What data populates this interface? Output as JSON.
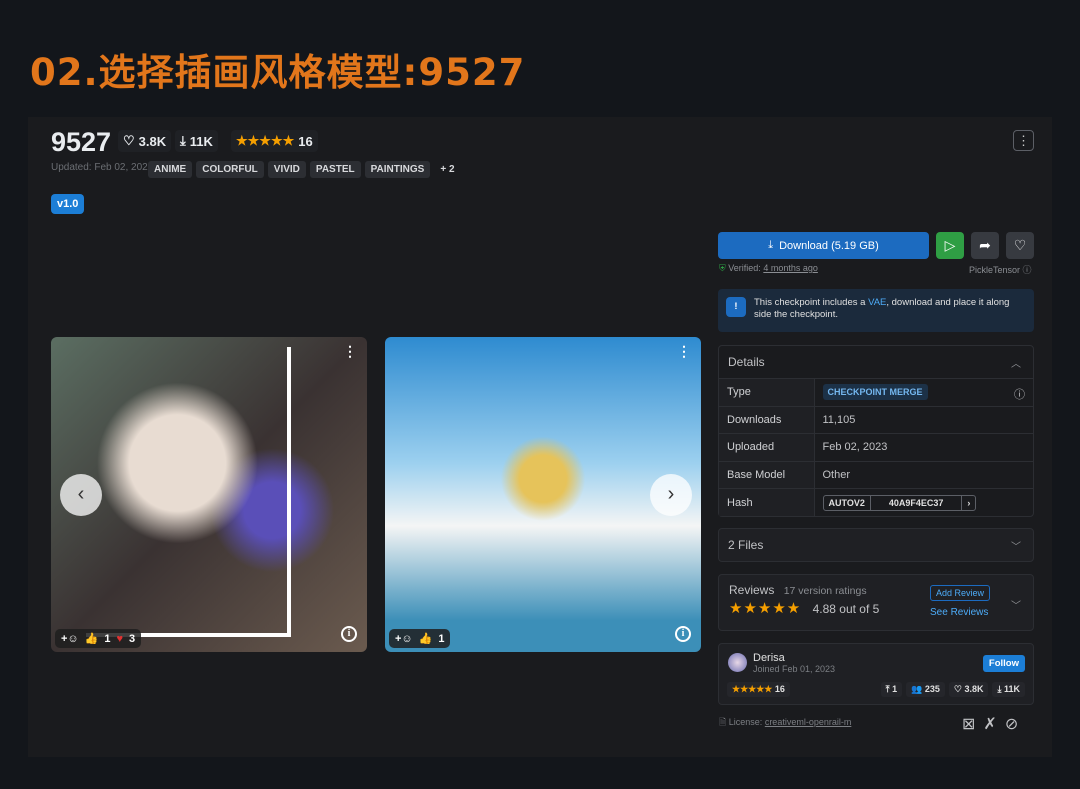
{
  "heading": "02.选择插画风格模型:9527",
  "model": {
    "title": "9527",
    "likes": "3.8K",
    "downloads": "11K",
    "rating_stars": 5,
    "rating_count": "16",
    "updated": "Updated: Feb 02, 2023",
    "tags": [
      "ANIME",
      "COLORFUL",
      "VIVID",
      "PASTEL",
      "PAINTINGS",
      "+ 2"
    ],
    "version": "v1.0"
  },
  "gallery": [
    {
      "thumbs_up": "1",
      "hearts": "3"
    },
    {
      "thumbs_up": "1"
    }
  ],
  "actions": {
    "download_label": "Download (5.19 GB)",
    "verified_prefix": "Verified:",
    "verified_time": "4 months ago",
    "verifier": "PickleTensor",
    "accent": "#1c6bc0",
    "run_color": "#2f9e44"
  },
  "alert": {
    "pre": "This checkpoint includes a ",
    "link": "VAE",
    "post": ", download and place it along side the checkpoint."
  },
  "details": {
    "title": "Details",
    "rows": [
      {
        "label": "Type",
        "value": "CHECKPOINT MERGE"
      },
      {
        "label": "Downloads",
        "value": "11,105"
      },
      {
        "label": "Uploaded",
        "value": "Feb 02, 2023"
      },
      {
        "label": "Base Model",
        "value": "Other"
      },
      {
        "label": "Hash",
        "hash_type": "AUTOV2",
        "hash": "40A9F4EC37"
      }
    ]
  },
  "files": {
    "title": "2 Files"
  },
  "reviews": {
    "title": "Reviews",
    "count": "17 version ratings",
    "score": "4.88 out of 5",
    "add": "Add Review",
    "see": "See Reviews"
  },
  "creator": {
    "name": "Derisa",
    "joined": "Joined Feb 01, 2023",
    "follow": "Follow",
    "rating_count": "16",
    "uploads": "1",
    "followers": "235",
    "likes": "3.8K",
    "downloads": "11K"
  },
  "license": {
    "label": "License:",
    "name": "creativeml-openrail-m"
  }
}
